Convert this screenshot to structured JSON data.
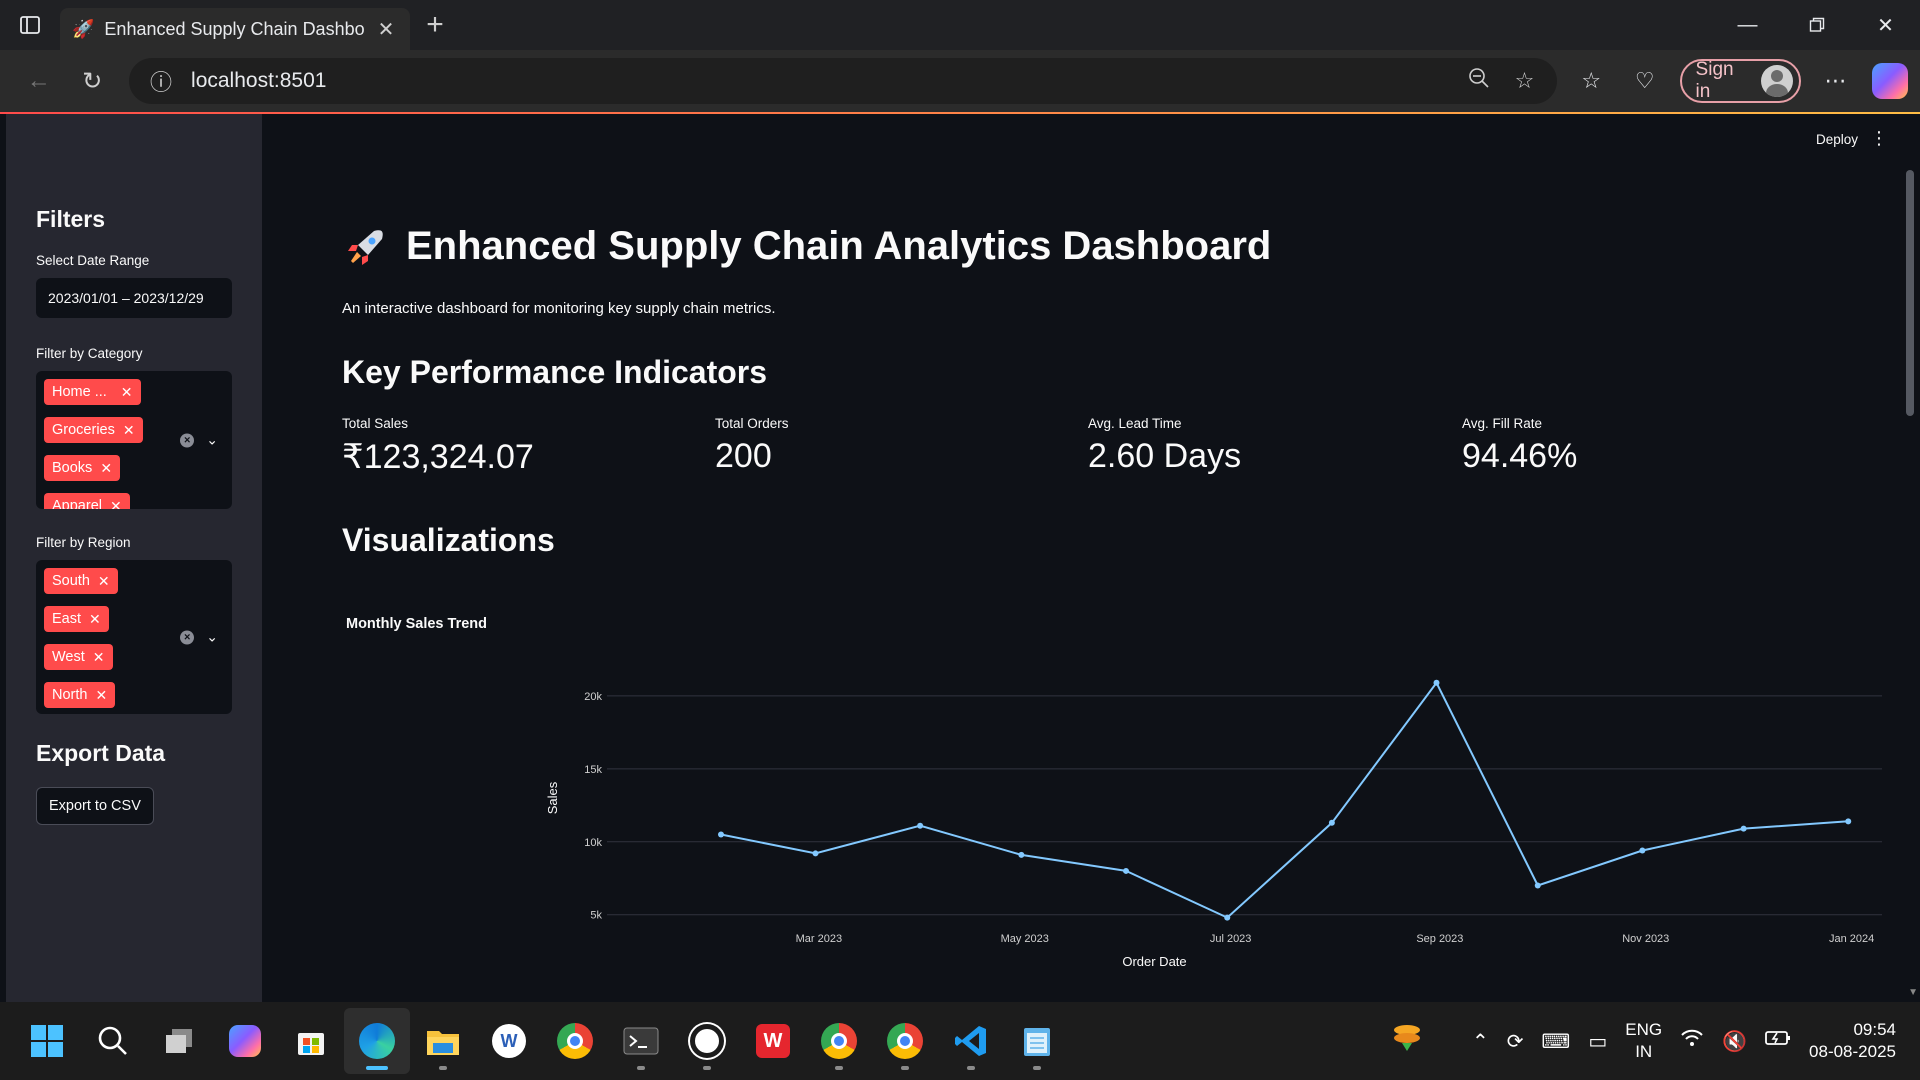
{
  "browser": {
    "tab_title": "Enhanced Supply Chain Dashboard",
    "url": "localhost:8501",
    "signin_label": "Sign in"
  },
  "app": {
    "deploy_label": "Deploy",
    "title": "Enhanced Supply Chain Analytics Dashboard",
    "subtitle": "An interactive dashboard for monitoring key supply chain metrics."
  },
  "sidebar": {
    "filters_heading": "Filters",
    "date_label": "Select Date Range",
    "date_value": "2023/01/01 – 2023/12/29",
    "category_label": "Filter by Category",
    "categories": [
      "Home ...",
      "Groceries",
      "Books",
      "Apparel"
    ],
    "region_label": "Filter by Region",
    "regions": [
      "South",
      "East",
      "West",
      "North"
    ],
    "export_heading": "Export Data",
    "export_button": "Export to CSV"
  },
  "kpis": {
    "heading": "Key Performance Indicators",
    "items": [
      {
        "label": "Total Sales",
        "value": "₹123,324.07"
      },
      {
        "label": "Total Orders",
        "value": "200"
      },
      {
        "label": "Avg. Lead Time",
        "value": "2.60 Days"
      },
      {
        "label": "Avg. Fill Rate",
        "value": "94.46%"
      }
    ]
  },
  "visualizations_heading": "Visualizations",
  "chart_data": {
    "type": "line",
    "title": "Monthly Sales Trend",
    "xlabel": "Order Date",
    "ylabel": "Sales",
    "x": [
      "2023-01-31",
      "2023-02-28",
      "2023-03-31",
      "2023-04-30",
      "2023-05-31",
      "2023-06-30",
      "2023-07-31",
      "2023-08-31",
      "2023-09-30",
      "2023-10-31",
      "2023-11-30",
      "2023-12-31"
    ],
    "values": [
      10500,
      9200,
      11100,
      9100,
      8000,
      4800,
      11300,
      20900,
      7000,
      9400,
      10900,
      11400
    ],
    "x_ticks": [
      "Mar 2023",
      "May 2023",
      "Jul 2023",
      "Sep 2023",
      "Nov 2023",
      "Jan 2024"
    ],
    "y_ticks": [
      "5k",
      "10k",
      "15k",
      "20k"
    ],
    "ylim": [
      4500,
      21500
    ],
    "grid": true,
    "line_color": "#83c9ff"
  },
  "taskbar": {
    "lang_top": "ENG",
    "lang_bottom": "IN",
    "time": "09:54",
    "date": "08-08-2025"
  }
}
